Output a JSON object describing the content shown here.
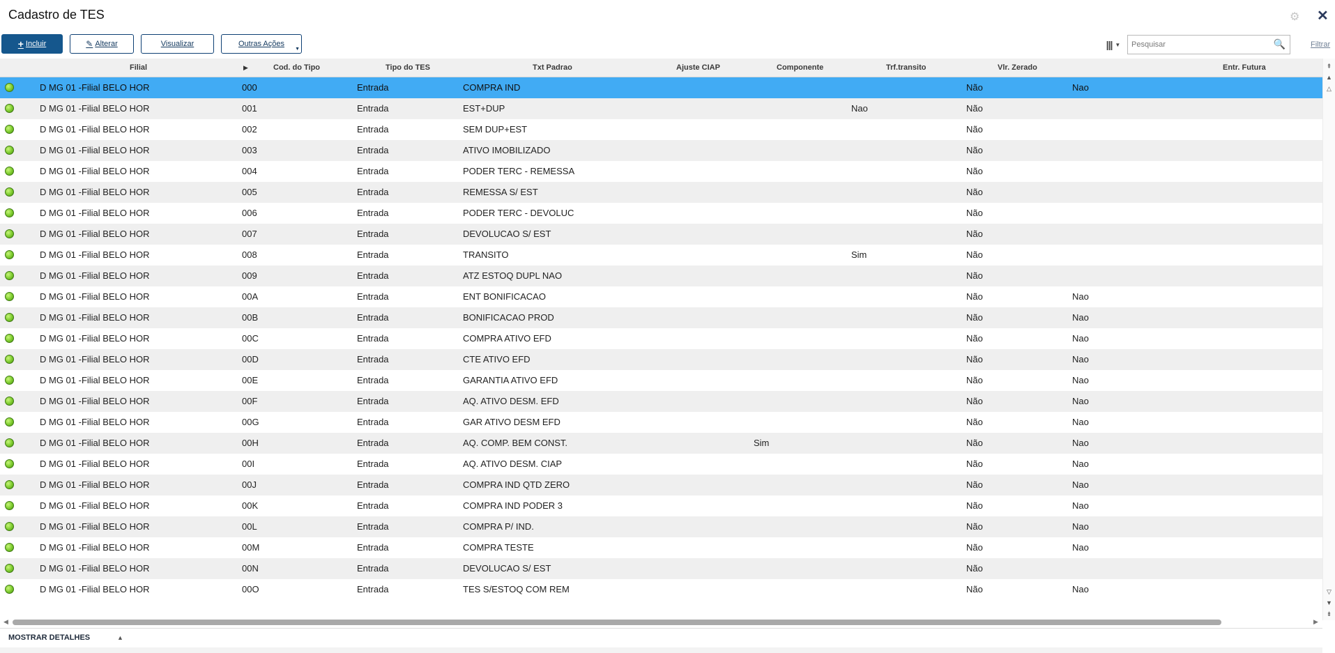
{
  "window": {
    "title": "Cadastro de TES"
  },
  "toolbar": {
    "incluir": "Incluir",
    "alterar": "Alterar",
    "visualizar": "Visualizar",
    "outras_acoes": "Outras Ações"
  },
  "search": {
    "placeholder": "Pesquisar",
    "filter_label": "Filtrar"
  },
  "table": {
    "columns": [
      "Filial",
      "Cod. do Tipo",
      "Tipo do TES",
      "Txt Padrao",
      "Ajuste CIAP",
      "Componente",
      "Trf.transito",
      "Vlr. Zerado",
      "Entr. Futura"
    ],
    "rows": [
      {
        "filial": "D MG 01 -Filial BELO HOR",
        "cod": "000",
        "tipo": "Entrada",
        "txt": "COMPRA IND",
        "ajuste": "",
        "componente": "",
        "trf": "",
        "vlr": "Não",
        "entr": "Nao"
      },
      {
        "filial": "D MG 01 -Filial BELO HOR",
        "cod": "001",
        "tipo": "Entrada",
        "txt": "EST+DUP",
        "ajuste": "",
        "componente": "",
        "trf": "Nao",
        "vlr": "Não",
        "entr": ""
      },
      {
        "filial": "D MG 01 -Filial BELO HOR",
        "cod": "002",
        "tipo": "Entrada",
        "txt": "SEM DUP+EST",
        "ajuste": "",
        "componente": "",
        "trf": "",
        "vlr": "Não",
        "entr": ""
      },
      {
        "filial": "D MG 01 -Filial BELO HOR",
        "cod": "003",
        "tipo": "Entrada",
        "txt": "ATIVO IMOBILIZADO",
        "ajuste": "",
        "componente": "",
        "trf": "",
        "vlr": "Não",
        "entr": ""
      },
      {
        "filial": "D MG 01 -Filial BELO HOR",
        "cod": "004",
        "tipo": "Entrada",
        "txt": "PODER TERC - REMESSA",
        "ajuste": "",
        "componente": "",
        "trf": "",
        "vlr": "Não",
        "entr": ""
      },
      {
        "filial": "D MG 01 -Filial BELO HOR",
        "cod": "005",
        "tipo": "Entrada",
        "txt": "REMESSA S/ EST",
        "ajuste": "",
        "componente": "",
        "trf": "",
        "vlr": "Não",
        "entr": ""
      },
      {
        "filial": "D MG 01 -Filial BELO HOR",
        "cod": "006",
        "tipo": "Entrada",
        "txt": "PODER TERC - DEVOLUC",
        "ajuste": "",
        "componente": "",
        "trf": "",
        "vlr": "Não",
        "entr": ""
      },
      {
        "filial": "D MG 01 -Filial BELO HOR",
        "cod": "007",
        "tipo": "Entrada",
        "txt": "DEVOLUCAO S/ EST",
        "ajuste": "",
        "componente": "",
        "trf": "",
        "vlr": "Não",
        "entr": ""
      },
      {
        "filial": "D MG 01 -Filial BELO HOR",
        "cod": "008",
        "tipo": "Entrada",
        "txt": "TRANSITO",
        "ajuste": "",
        "componente": "",
        "trf": "Sim",
        "vlr": "Não",
        "entr": ""
      },
      {
        "filial": "D MG 01 -Filial BELO HOR",
        "cod": "009",
        "tipo": "Entrada",
        "txt": "ATZ ESTOQ DUPL NAO",
        "ajuste": "",
        "componente": "",
        "trf": "",
        "vlr": "Não",
        "entr": ""
      },
      {
        "filial": "D MG 01 -Filial BELO HOR",
        "cod": "00A",
        "tipo": "Entrada",
        "txt": "ENT BONIFICACAO",
        "ajuste": "",
        "componente": "",
        "trf": "",
        "vlr": "Não",
        "entr": "Nao"
      },
      {
        "filial": "D MG 01 -Filial BELO HOR",
        "cod": "00B",
        "tipo": "Entrada",
        "txt": "BONIFICACAO PROD",
        "ajuste": "",
        "componente": "",
        "trf": "",
        "vlr": "Não",
        "entr": "Nao"
      },
      {
        "filial": "D MG 01 -Filial BELO HOR",
        "cod": "00C",
        "tipo": "Entrada",
        "txt": "COMPRA ATIVO EFD",
        "ajuste": "",
        "componente": "",
        "trf": "",
        "vlr": "Não",
        "entr": "Nao"
      },
      {
        "filial": "D MG 01 -Filial BELO HOR",
        "cod": "00D",
        "tipo": "Entrada",
        "txt": "CTE ATIVO EFD",
        "ajuste": "",
        "componente": "",
        "trf": "",
        "vlr": "Não",
        "entr": "Nao"
      },
      {
        "filial": "D MG 01 -Filial BELO HOR",
        "cod": "00E",
        "tipo": "Entrada",
        "txt": "GARANTIA ATIVO EFD",
        "ajuste": "",
        "componente": "",
        "trf": "",
        "vlr": "Não",
        "entr": "Nao"
      },
      {
        "filial": "D MG 01 -Filial BELO HOR",
        "cod": "00F",
        "tipo": "Entrada",
        "txt": "AQ. ATIVO DESM. EFD",
        "ajuste": "",
        "componente": "",
        "trf": "",
        "vlr": "Não",
        "entr": "Nao"
      },
      {
        "filial": "D MG 01 -Filial BELO HOR",
        "cod": "00G",
        "tipo": "Entrada",
        "txt": "GAR ATIVO DESM EFD",
        "ajuste": "",
        "componente": "",
        "trf": "",
        "vlr": "Não",
        "entr": "Nao"
      },
      {
        "filial": "D MG 01 -Filial BELO HOR",
        "cod": "00H",
        "tipo": "Entrada",
        "txt": "AQ. COMP. BEM CONST.",
        "ajuste": "",
        "componente": "Sim",
        "trf": "",
        "vlr": "Não",
        "entr": "Nao"
      },
      {
        "filial": "D MG 01 -Filial BELO HOR",
        "cod": "00I",
        "tipo": "Entrada",
        "txt": "AQ. ATIVO DESM. CIAP",
        "ajuste": "",
        "componente": "",
        "trf": "",
        "vlr": "Não",
        "entr": "Nao"
      },
      {
        "filial": "D MG 01 -Filial BELO HOR",
        "cod": "00J",
        "tipo": "Entrada",
        "txt": "COMPRA IND QTD ZERO",
        "ajuste": "",
        "componente": "",
        "trf": "",
        "vlr": "Não",
        "entr": "Nao"
      },
      {
        "filial": "D MG 01 -Filial BELO HOR",
        "cod": "00K",
        "tipo": "Entrada",
        "txt": "COMPRA IND PODER 3",
        "ajuste": "",
        "componente": "",
        "trf": "",
        "vlr": "Não",
        "entr": "Nao"
      },
      {
        "filial": "D MG 01 -Filial BELO HOR",
        "cod": "00L",
        "tipo": "Entrada",
        "txt": "COMPRA P/ IND.",
        "ajuste": "",
        "componente": "",
        "trf": "",
        "vlr": "Não",
        "entr": "Nao"
      },
      {
        "filial": "D MG 01 -Filial BELO HOR",
        "cod": "00M",
        "tipo": "Entrada",
        "txt": "COMPRA TESTE",
        "ajuste": "",
        "componente": "",
        "trf": "",
        "vlr": "Não",
        "entr": "Nao"
      },
      {
        "filial": "D MG 01 -Filial BELO HOR",
        "cod": "00N",
        "tipo": "Entrada",
        "txt": "DEVOLUCAO S/ EST",
        "ajuste": "",
        "componente": "",
        "trf": "",
        "vlr": "Não",
        "entr": ""
      },
      {
        "filial": "D MG 01 -Filial BELO HOR",
        "cod": "00O",
        "tipo": "Entrada",
        "txt": "TES S/ESTOQ COM REM",
        "ajuste": "",
        "componente": "",
        "trf": "",
        "vlr": "Não",
        "entr": "Nao"
      }
    ]
  },
  "footer": {
    "details_label": "MOSTRAR DETALHES"
  },
  "icons": {
    "status": "status-green-icon",
    "add": "plus-icon",
    "edit": "pencil-icon",
    "search": "magnifier-icon",
    "columns": "columns-icon",
    "close": "close-icon",
    "gear": "gear-icon"
  },
  "colors": {
    "primary": "#15578d",
    "selected_row": "#41abf4",
    "status_green": "#7ccb2d"
  }
}
